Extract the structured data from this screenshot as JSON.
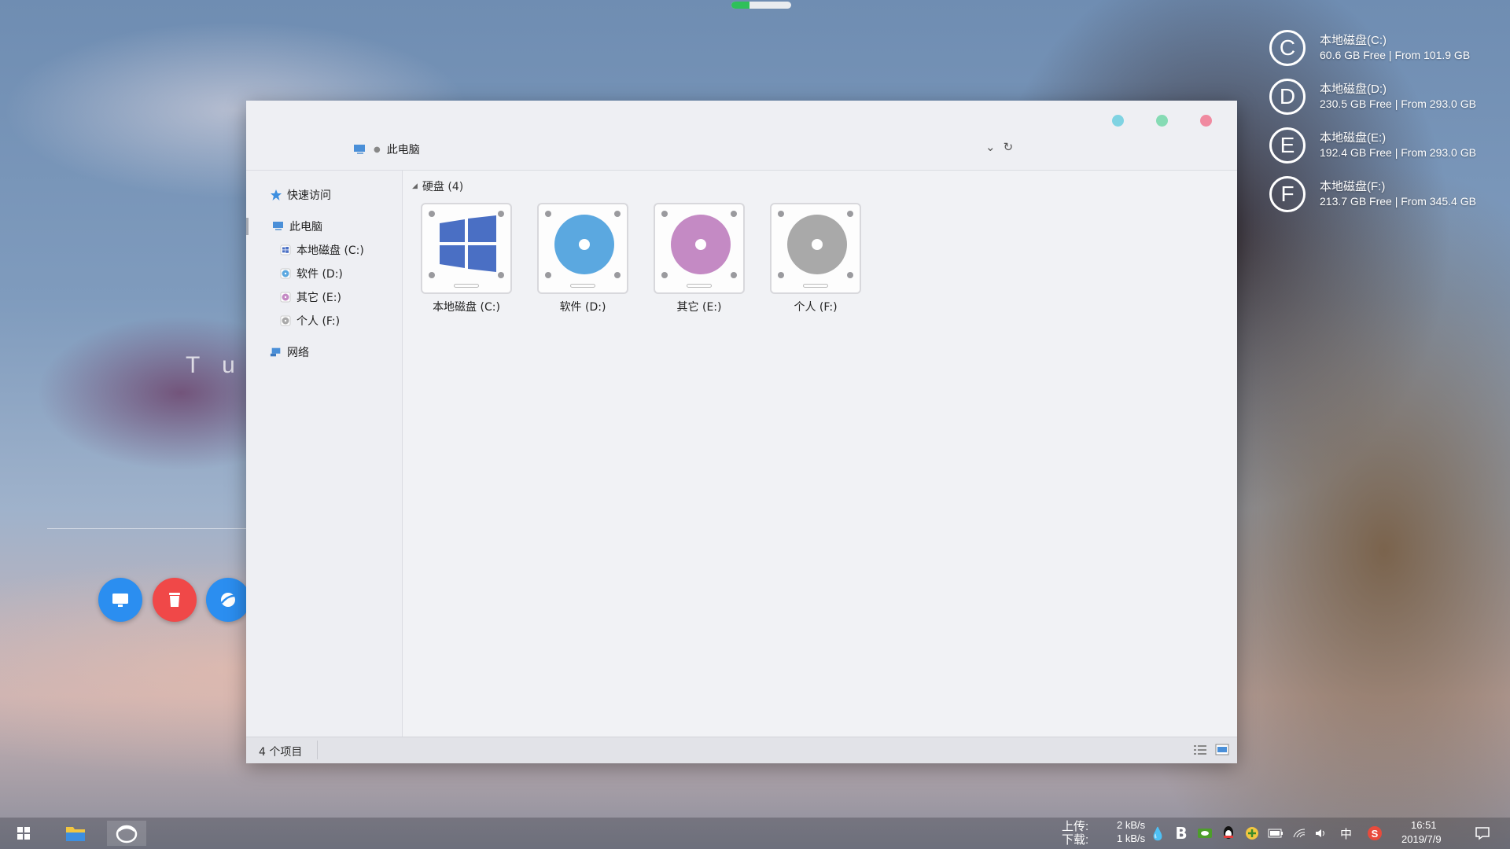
{
  "progress_indicator": {
    "fraction": 0.3,
    "color": "#2fc05a"
  },
  "desktop": {
    "clock_fragment": "T u e",
    "circle_buttons": [
      {
        "name": "monitor",
        "color": "#2b8ef0"
      },
      {
        "name": "trash",
        "color": "#f04848"
      },
      {
        "name": "browser",
        "color": "#2b8ef0"
      }
    ]
  },
  "drive_widget": [
    {
      "letter": "C",
      "name": "本地磁盘(C:)",
      "info": "60.6 GB Free | From 101.9 GB"
    },
    {
      "letter": "D",
      "name": "本地磁盘(D:)",
      "info": "230.5 GB Free | From 293.0 GB"
    },
    {
      "letter": "E",
      "name": "本地磁盘(E:)",
      "info": "192.4 GB Free | From 293.0 GB"
    },
    {
      "letter": "F",
      "name": "本地磁盘(F:)",
      "info": "213.7 GB Free | From 345.4 GB"
    }
  ],
  "window": {
    "controls": {
      "minimize": "#7fd3e2",
      "maximize": "#86dbb4",
      "close": "#f08aa0"
    },
    "address": {
      "location": "此电脑"
    },
    "sidebar": {
      "quick_access": "快速访问",
      "this_pc": "此电脑",
      "drives": [
        {
          "label": "本地磁盘 (C:)",
          "color": "#4a6fc4"
        },
        {
          "label": "软件 (D:)",
          "color": "#5ba8e0"
        },
        {
          "label": "其它 (E:)",
          "color": "#c48ac4"
        },
        {
          "label": "个人 (F:)",
          "color": "#a9a9a9"
        }
      ],
      "network": "网络"
    },
    "content": {
      "group_header": "硬盘 (4)",
      "drives": [
        {
          "label": "本地磁盘 (C:)",
          "kind": "windows",
          "color": "#4a6fc4"
        },
        {
          "label": "软件 (D:)",
          "kind": "disc",
          "color": "#5ba8e0"
        },
        {
          "label": "其它 (E:)",
          "kind": "disc",
          "color": "#c48ac4"
        },
        {
          "label": "个人 (F:)",
          "kind": "disc",
          "color": "#a9a9a9"
        }
      ]
    },
    "status": {
      "item_count": "4 个项目"
    }
  },
  "taskbar": {
    "upload_label": "上传:",
    "download_label": "下载:",
    "upload_speed": "2 kB/s",
    "download_speed": "1 kB/s",
    "ime": "中",
    "time": "16:51",
    "date": "2019/7/9"
  }
}
